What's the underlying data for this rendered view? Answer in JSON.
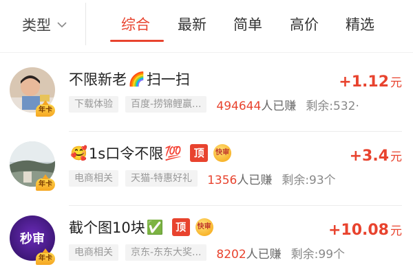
{
  "header": {
    "type_filter_label": "类型",
    "tabs": [
      {
        "label": "综合",
        "active": true
      },
      {
        "label": "最新"
      },
      {
        "label": "简单"
      },
      {
        "label": "高价"
      },
      {
        "label": "精选"
      }
    ]
  },
  "colors": {
    "accent": "#e8432e",
    "tag_bg": "#f3f3f3",
    "badge_gold": "#f5a623"
  },
  "tasks": [
    {
      "title": "不限新老",
      "title_emoji": "🌈",
      "title_suffix": "扫一扫",
      "tags": [
        "下载体验",
        "百度-捞锦鲤赢..."
      ],
      "earned_count": "494644",
      "earned_suffix": "人已赚",
      "remaining": "剩余:532·",
      "reward_amount": "+1.12",
      "reward_unit": "元",
      "vip_badge": "年卡"
    },
    {
      "title_emoji_prefix": "🥰",
      "title": "1s口令不限",
      "title_emoji": "💯",
      "top_badge": "顶",
      "fast_badge": "快审",
      "tags": [
        "电商相关",
        "天猫-特惠好礼"
      ],
      "earned_count": "1356",
      "earned_suffix": "人已赚",
      "remaining": "剩余:93个",
      "reward_amount": "+3.4",
      "reward_unit": "元",
      "vip_badge": "年卡"
    },
    {
      "title": "截个图10块",
      "title_emoji": "✅",
      "top_badge": "顶",
      "fast_badge": "快审",
      "tags": [
        "电商相关",
        "京东-东东大奖..."
      ],
      "earned_count": "8202",
      "earned_suffix": "人已赚",
      "remaining": "剩余:99个",
      "reward_amount": "+10.08",
      "reward_unit": "元",
      "avatar_text": "秒审",
      "vip_badge": "年卡"
    }
  ]
}
